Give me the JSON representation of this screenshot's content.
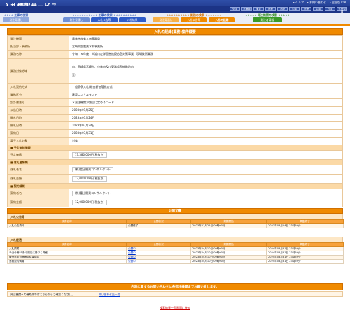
{
  "header": {
    "logo": "入札情報サービス",
    "links": [
      "ヘルプ",
      "お問い合わせ",
      "全国版TOP"
    ],
    "regions": [
      "全国",
      "北海道",
      "東北",
      "関東",
      "北陸",
      "中部",
      "近畿",
      "中国",
      "四国",
      "九州沖縄"
    ]
  },
  "nav": {
    "groups": [
      {
        "title": "工事の検索",
        "tabs": [
          "発注見通し",
          "入札公告等",
          "入札結果"
        ],
        "color": "blue"
      },
      {
        "title": "業務の検索",
        "tabs": [
          "発注見通し",
          "入札公告等",
          "入札の経緯"
        ],
        "color": "orange",
        "active": "入札の経緯"
      },
      {
        "title": "発注機関の検索",
        "tabs": [
          "発注者情報"
        ],
        "color": "green"
      }
    ],
    "left_tabs": [
      "発注見通し",
      "入札公告等",
      "入札の経緯",
      "入札結果"
    ],
    "left_title": "工事の検索"
  },
  "detail": {
    "title": "入札の経緯(業務)案件概要",
    "rows": [
      {
        "label": "発注機関",
        "value": "農林水産省九州農政局"
      },
      {
        "label": "担当部・事務所",
        "value": "宮崎中部農業水利事業所"
      },
      {
        "label": "業務名称",
        "value": "令和　５年度　大淀川左岸国営施設応急対策事業　現場技術業務"
      },
      {
        "label": "業務対象地域",
        "value": "自：宮崎県宮崎市、小林市及び東諸県郡綾町地内",
        "value2": "至："
      },
      {
        "label": "入札契約方式",
        "value": "一般競争入札(総合評価落札方式)"
      },
      {
        "label": "業務区分",
        "value": "建設コンサルタント"
      },
      {
        "label": "設計書番号",
        "value": "＊発注機関が独自に定めるコード"
      },
      {
        "label": "公告日時",
        "value": "2023年01月25日"
      },
      {
        "label": "開札日時",
        "value": "2023年03月24日"
      },
      {
        "label": "開札日時",
        "value": "2023年03月24日"
      },
      {
        "label": "契約日",
        "value": "2023年03月31日"
      },
      {
        "label": "電子入札対象",
        "value": "対象"
      }
    ],
    "price_head": "予定価格情報",
    "price_label": "予定価格",
    "price_value": "17,380,000円(税抜き)",
    "bid_head": "落札者情報",
    "bid_rows": [
      {
        "label": "落札者名",
        "value": "(株)富士開発コンサルタント"
      },
      {
        "label": "落札金額",
        "value": "12,000,000円(税抜き)"
      }
    ],
    "contract_head": "契約情報",
    "contract_rows": [
      {
        "label": "契約者名",
        "value": "(株)富士開発コンサルタント"
      },
      {
        "label": "契約金額",
        "value": "12,000,000円(税抜き)"
      }
    ]
  },
  "documents": {
    "title": "公開文書",
    "sections": [
      {
        "name": "入札公告等",
        "headers": [
          "文書名称",
          "公開状況",
          "掲載開始",
          "掲載終了"
        ],
        "rows": [
          [
            "入札公告資料",
            "公開終了",
            "2023年01月25日 09時00分",
            "2023年03月24日 23時59分"
          ]
        ]
      },
      {
        "name": "入札経過",
        "headers": [
          "文書名称",
          "公開状況",
          "掲載開始",
          "掲載終了"
        ],
        "rows": [
          [
            "入札調書",
            "公開中",
            "2023年04月10日 09時00分",
            "2024年03月31日 23時59分"
          ],
          [
            "予決令第85条の規定に基づく資格",
            "公開中",
            "2023年04月10日 09時00分",
            "2024年03月31日 23時59分"
          ],
          [
            "競争参加資格確認結果調書",
            "公開中",
            "2023年04月10日 09時00分",
            "2024年03月31日 23時59分"
          ],
          [
            "業務契約情報",
            "公開中",
            "2023年04月10日 09時00分",
            "2024年03月31日 23時59分"
          ]
        ]
      }
    ]
  },
  "notice": {
    "title": "内容に関するお問い合わせは各発注機関までお願い致します。",
    "text": "発注機関への連絡先等はこちらからご確認ください。",
    "link": "問い合わせ先一覧"
  },
  "back_link": "検索結果一覧画面に戻る"
}
